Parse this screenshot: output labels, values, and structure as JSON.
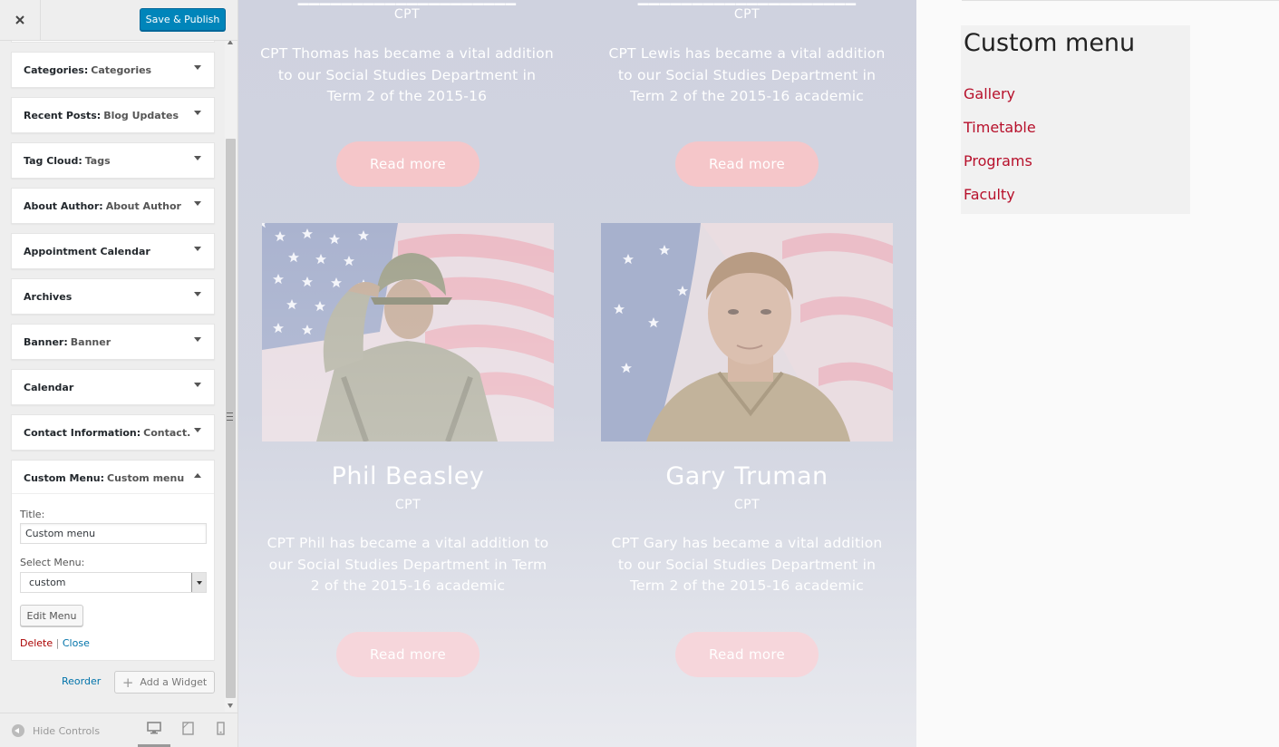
{
  "header": {
    "close_icon": "close-icon",
    "publish_label": "Save & Publish"
  },
  "widgets": [
    {
      "name": "Categories:",
      "subtitle": "Categories"
    },
    {
      "name": "Recent Posts:",
      "subtitle": "Blog Updates"
    },
    {
      "name": "Tag Cloud:",
      "subtitle": "Tags"
    },
    {
      "name": "About Author:",
      "subtitle": "About Author"
    },
    {
      "name": "Appointment Calendar",
      "subtitle": ""
    },
    {
      "name": "Archives",
      "subtitle": ""
    },
    {
      "name": "Banner:",
      "subtitle": "Banner"
    },
    {
      "name": "Calendar",
      "subtitle": ""
    },
    {
      "name": "Contact Information:",
      "subtitle": "Contact..."
    }
  ],
  "expanded_widget": {
    "name": "Custom Menu:",
    "subtitle": "Custom menu",
    "title_label": "Title:",
    "title_value": "Custom menu",
    "select_label": "Select Menu:",
    "select_value": "custom",
    "edit_menu_label": "Edit Menu",
    "delete_label": "Delete",
    "separator": "|",
    "close_label": "Close"
  },
  "widget_actions": {
    "reorder_label": "Reorder",
    "add_widget_label": "Add a Widget"
  },
  "footer": {
    "hide_controls_label": "Hide Controls",
    "devices": [
      "desktop-icon",
      "tablet-icon",
      "mobile-icon"
    ]
  },
  "preview": {
    "top_cards": [
      {
        "role": "CPT",
        "description": "CPT Thomas has became a vital addition to our Social Studies Department in Term 2 of the 2015-16",
        "button": "Read more"
      },
      {
        "role": "CPT",
        "description": "CPT Lewis has became a vital addition to our Social Studies Department in Term 2 of the 2015-16 academic",
        "button": "Read more"
      }
    ],
    "bottom_cards": [
      {
        "name": "Phil Beasley",
        "role": "CPT",
        "description": "CPT Phil has became a vital addition to our Social Studies Department in Term 2 of the 2015-16 academic",
        "button": "Read more"
      },
      {
        "name": "Gary Truman",
        "role": "CPT",
        "description": "CPT Gary has became a vital addition to our Social Studies Department in Term 2 of the 2015-16 academic",
        "button": "Read more"
      }
    ]
  },
  "custom_menu": {
    "title": "Custom menu",
    "items": [
      "Gallery",
      "Timetable",
      "Programs",
      "Faculty"
    ],
    "link_color": "#b7102b"
  },
  "colors": {
    "primary_button": "#0085ba",
    "link": "#0073aa",
    "delete": "#a00000"
  }
}
